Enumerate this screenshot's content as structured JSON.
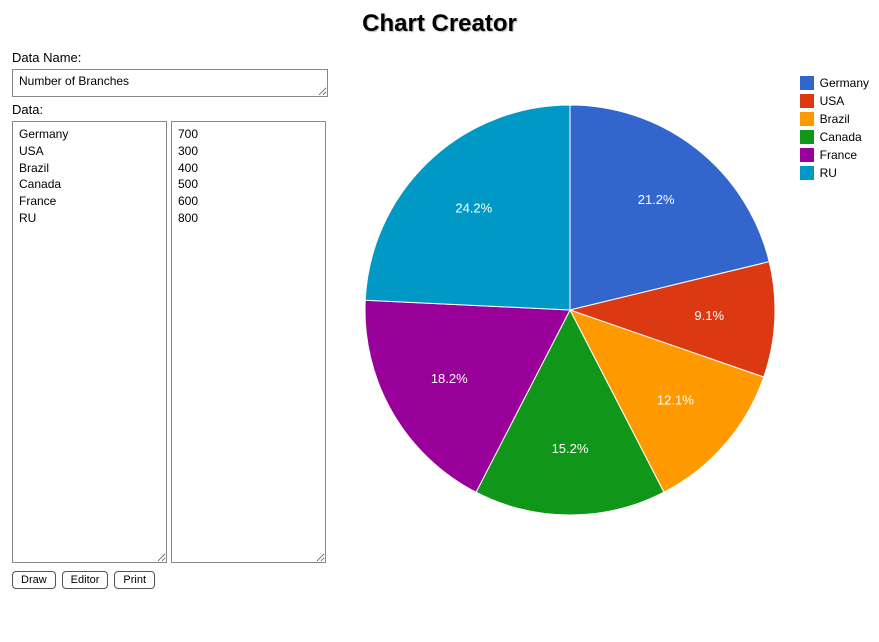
{
  "page_title": "Chart Creator",
  "form": {
    "data_name_label": "Data Name:",
    "data_name_value": "Number of Branches",
    "data_label": "Data:",
    "categories_text": "Germany\nUSA\nBrazil\nCanada\nFrance\nRU",
    "values_text": "700\n300\n400\n500\n600\n800"
  },
  "buttons": {
    "draw": "Draw",
    "editor": "Editor",
    "print": "Print"
  },
  "chart_data": {
    "type": "pie",
    "title": "Chart Creator",
    "series": [
      {
        "name": "Germany",
        "value": 700,
        "pct": "21.2%",
        "color": "#3366cc"
      },
      {
        "name": "USA",
        "value": 300,
        "pct": "9.1%",
        "color": "#dc3912"
      },
      {
        "name": "Brazil",
        "value": 400,
        "pct": "12.1%",
        "color": "#ff9900"
      },
      {
        "name": "Canada",
        "value": 500,
        "pct": "15.2%",
        "color": "#109618"
      },
      {
        "name": "France",
        "value": 600,
        "pct": "18.2%",
        "color": "#990099"
      },
      {
        "name": "RU",
        "value": 800,
        "pct": "24.2%",
        "color": "#0099c6"
      }
    ]
  }
}
